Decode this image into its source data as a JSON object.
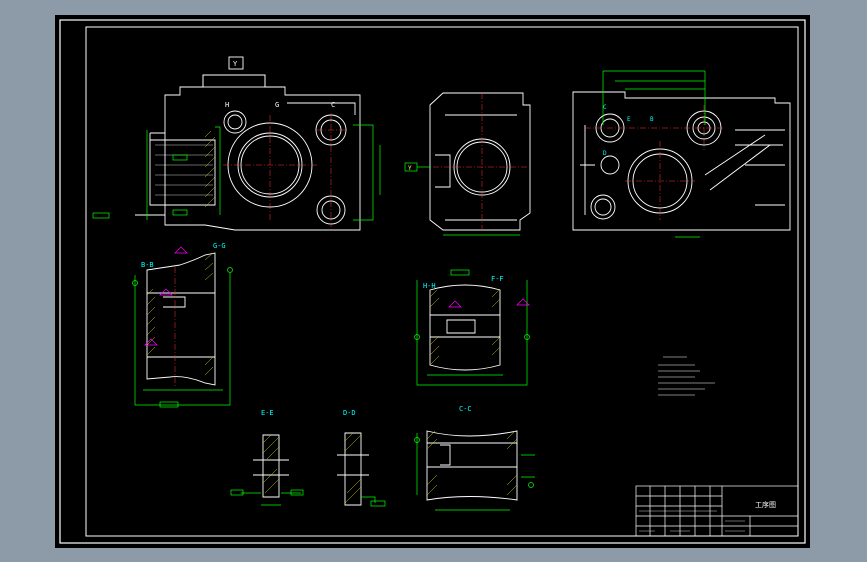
{
  "view_labels": {
    "top_right_center": "C",
    "top_left_h": "H",
    "top_left_g": "G",
    "box_y": "Y",
    "left_marker_y": "Y",
    "view_b": "B-B",
    "view_g": "G-G",
    "view_h": "H-H",
    "view_f": "F-F",
    "view_e": "E-E",
    "view_d": "D-D",
    "view_c": "C-C"
  },
  "right_view_marks": {
    "c1": "C",
    "e1": "E",
    "b1": "B",
    "d1": "D"
  },
  "title_block": {
    "drawing_name": "工序图"
  },
  "colors": {
    "background": "#000000",
    "frame": "#ffffff",
    "dimension": "#00ff00",
    "centerline": "#ff3030",
    "section_label": "#00ffff",
    "annotation": "#ff00ff",
    "hatch": "#cccc00"
  }
}
